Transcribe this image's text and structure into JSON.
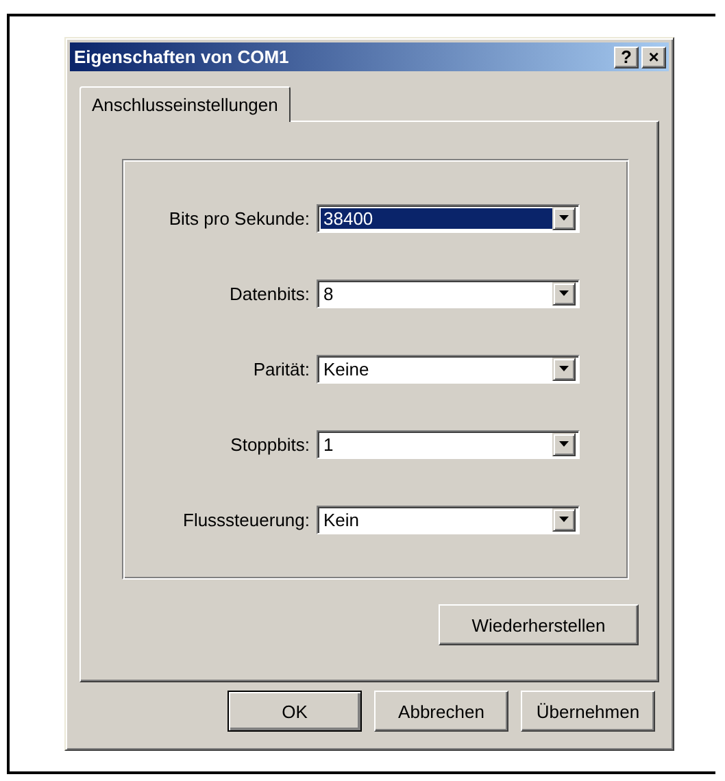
{
  "window": {
    "title": "Eigenschaften von COM1",
    "title_buttons": [
      "?",
      "×"
    ]
  },
  "tabs": [
    {
      "label": "Anschlusseinstellungen",
      "selected": true
    }
  ],
  "fields": [
    {
      "label": "Bits pro Sekunde:",
      "value": "38400",
      "selected": true
    },
    {
      "label": "Datenbits:",
      "value": "8",
      "selected": false
    },
    {
      "label": "Parität:",
      "value": "Keine",
      "selected": false
    },
    {
      "label": "Stoppbits:",
      "value": "1",
      "selected": false
    },
    {
      "label": "Flusssteuerung:",
      "value": "Kein",
      "selected": false
    }
  ],
  "restore_button": "Wiederherstellen",
  "buttons": [
    {
      "label": "OK",
      "default": true
    },
    {
      "label": "Abbrechen",
      "default": false
    },
    {
      "label": "Übernehmen",
      "default": false
    }
  ]
}
